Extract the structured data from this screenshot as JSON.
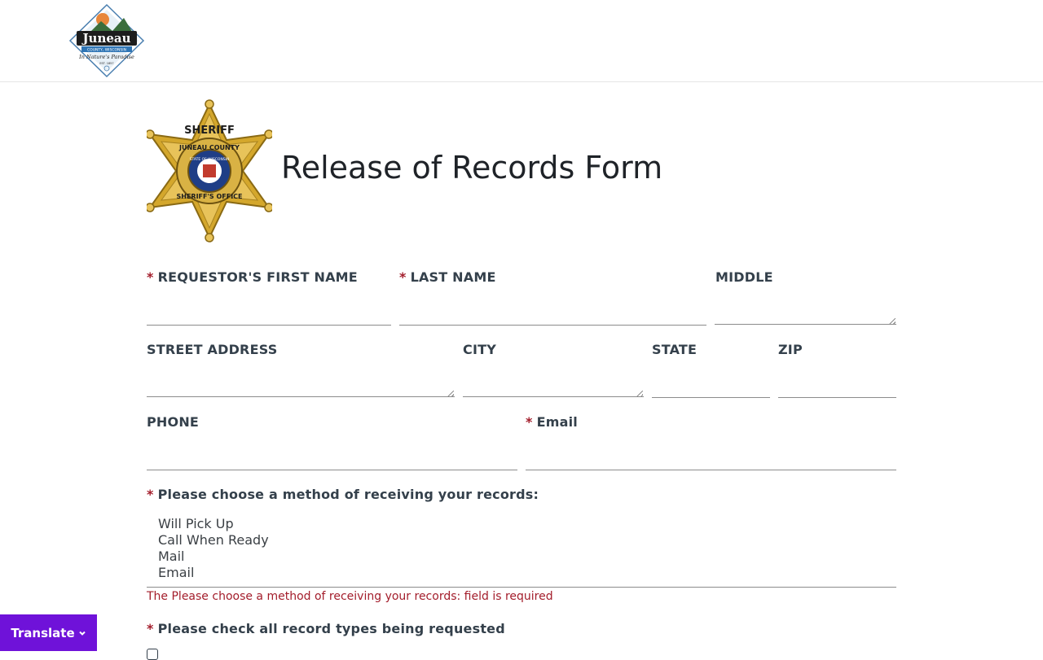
{
  "header": {
    "logo_text": "Juneau",
    "logo_subtitle": "COUNTY, WISCONSIN",
    "logo_tagline": "In Nature's Paradise",
    "logo_est": "EST. 1857"
  },
  "badge": {
    "top_text": "SHERIFF",
    "ring_text_top": "JUNEAU COUNTY",
    "ring_text_bottom": "SHERIFF'S OFFICE",
    "seal_text": "STATE OF WISCONSIN"
  },
  "form": {
    "title": "Release of Records Form",
    "required_marker": "*",
    "labels": {
      "first_name": "REQUESTOR'S FIRST NAME",
      "last_name": "LAST NAME",
      "middle": "MIDDLE",
      "street": "STREET ADDRESS",
      "city": "CITY",
      "state": "STATE",
      "zip": "ZIP",
      "phone": "PHONE",
      "email": "Email",
      "method": "Please choose a method of receiving your records:",
      "record_types": "Please check all record types being requested"
    },
    "values": {
      "first_name": "",
      "last_name": "",
      "middle": "",
      "street": "",
      "city": "",
      "state": "",
      "zip": "",
      "phone": "",
      "email": ""
    },
    "method_options": [
      "Will Pick Up",
      "Call When Ready",
      "Mail",
      "Email"
    ],
    "method_error": "The Please choose a method of receiving your records: field is required"
  },
  "translate": {
    "label": "Translate"
  },
  "colors": {
    "required": "#a31d2b",
    "error": "#a31d2b",
    "translate_bg": "#6f12d9",
    "label": "#34404b",
    "badge_gold": "#d4a72c"
  }
}
